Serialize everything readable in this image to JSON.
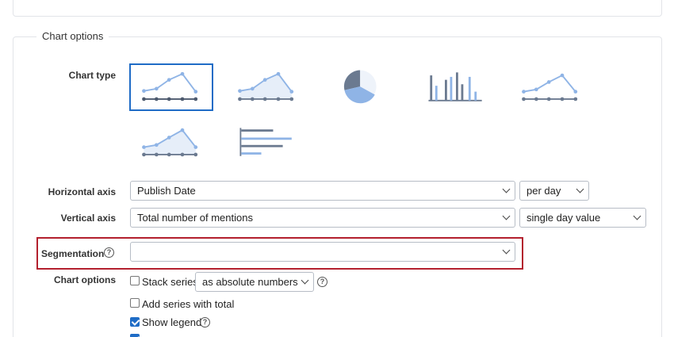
{
  "section": {
    "legend": "Chart options"
  },
  "chart_type": {
    "label": "Chart type",
    "options": [
      {
        "id": "line",
        "icon": "line-chart-icon",
        "selected": true
      },
      {
        "id": "area",
        "icon": "area-chart-icon",
        "selected": false
      },
      {
        "id": "pie",
        "icon": "pie-chart-icon",
        "selected": false
      },
      {
        "id": "bar",
        "icon": "bar-chart-icon",
        "selected": false
      },
      {
        "id": "spline",
        "icon": "spline-chart-icon",
        "selected": false
      },
      {
        "id": "area-spline",
        "icon": "area-spline-chart-icon",
        "selected": false
      },
      {
        "id": "horizontal-bar",
        "icon": "horizontal-bar-chart-icon",
        "selected": false
      }
    ]
  },
  "horizontal_axis": {
    "label": "Horizontal axis",
    "value": "Publish Date",
    "interval": "per day"
  },
  "vertical_axis": {
    "label": "Vertical axis",
    "value": "Total number of mentions",
    "mode": "single day value"
  },
  "segmentation": {
    "label": "Segmentation",
    "value": ""
  },
  "chart_options": {
    "label": "Chart options",
    "stack_series": {
      "label": "Stack series",
      "checked": false,
      "mode": "as absolute numbers"
    },
    "add_total": {
      "label": "Add series with total",
      "checked": false
    },
    "show_legend": {
      "label": "Show legend",
      "checked": true
    }
  },
  "colors": {
    "accent": "#1f6cc6",
    "highlight": "#b3202e",
    "light_series": "#8fb4e6",
    "dark_series": "#6b7a90"
  }
}
